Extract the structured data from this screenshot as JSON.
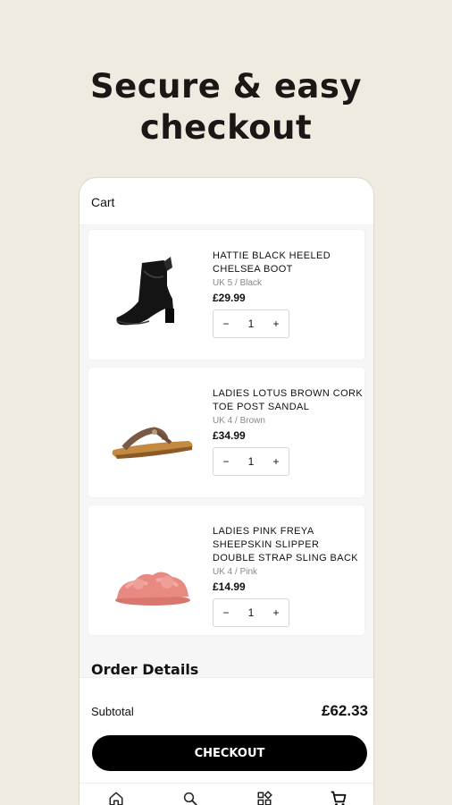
{
  "headline": {
    "line1": "Secure & easy",
    "line2": "checkout"
  },
  "cart": {
    "title": "Cart",
    "items": [
      {
        "name": "HATTIE BLACK HEELED CHELSEA BOOT",
        "variant": "UK 5 / Black",
        "price": "£29.99",
        "quantity": "1",
        "image": "black-heeled-chelsea-boot"
      },
      {
        "name": "LADIES LOTUS BROWN CORK TOE POST SANDAL",
        "variant": "UK 4 / Brown",
        "price": "£34.99",
        "quantity": "1",
        "image": "brown-cork-sandal"
      },
      {
        "name": "LADIES PINK FREYA SHEEPSKIN SLIPPER DOUBLE STRAP SLING BACK",
        "variant": "UK 4 / Pink",
        "price": "£14.99",
        "quantity": "1",
        "image": "pink-sheepskin-slipper"
      }
    ],
    "stepper": {
      "minus": "−",
      "plus": "+"
    }
  },
  "order": {
    "heading": "Order Details",
    "subtotal_label": "Subtotal",
    "subtotal_value": "£62.33",
    "checkout_label": "CHECKOUT"
  },
  "nav": {
    "icons": [
      "home-icon",
      "search-icon",
      "categories-icon",
      "cart-icon"
    ]
  },
  "colors": {
    "background": "#efebe1",
    "button": "#000000",
    "card": "#ffffff"
  }
}
